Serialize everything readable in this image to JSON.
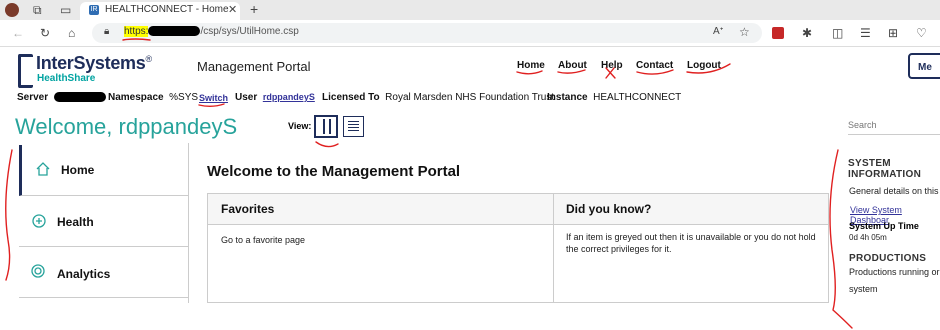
{
  "browser": {
    "tab_title": "HEALTHCONNECT - Home",
    "tab_favicon": "IR",
    "url_scheme": "https:",
    "url_path": "/csp/sys/UtilHome.csp"
  },
  "header": {
    "logo_text": "InterSystems",
    "logo_trademark": "®",
    "logo_sub": "HealthShare",
    "portal_title": "Management Portal",
    "nav": [
      "Home",
      "About",
      "Help",
      "Contact",
      "Logout"
    ],
    "menu_label": "Me"
  },
  "info": {
    "server_label": "Server",
    "namespace_label": "Namespace",
    "namespace_value": "%SYS",
    "switch_label": "Switch",
    "user_label": "User",
    "user_value": "rdppandeyS",
    "licensed_label": "Licensed To",
    "licensed_value": "Royal Marsden NHS Foundation Trust",
    "instance_label": "Instance",
    "instance_value": "HEALTHCONNECT"
  },
  "welcome": "Welcome, rdppandeyS",
  "view_label": "View:",
  "search_placeholder": "Search",
  "leftnav": [
    "Home",
    "Health",
    "Analytics"
  ],
  "main": {
    "title": "Welcome to the Management Portal",
    "favorites_header": "Favorites",
    "favorites_text": "Go to a favorite page",
    "didyouknow_header": "Did you know?",
    "didyouknow_text": "If an item is greyed out then it is unavailable or you do not hold the correct privileges for it."
  },
  "sidebar": {
    "system_info_title_1": "SYSTEM",
    "system_info_title_2": "INFORMATION",
    "system_info_desc": "General details on this",
    "dashboard_link": "View System Dashboar",
    "uptime_label": "System Up Time",
    "uptime_value": "0d 4h 05m",
    "productions_title": "PRODUCTIONS",
    "productions_desc_1": "Productions running or",
    "productions_desc_2": "system"
  },
  "colors": {
    "brand_navy": "#1e2d5a",
    "brand_teal": "#27a39b",
    "annotation_red": "#e02020",
    "url_highlight": "#ffff00"
  }
}
